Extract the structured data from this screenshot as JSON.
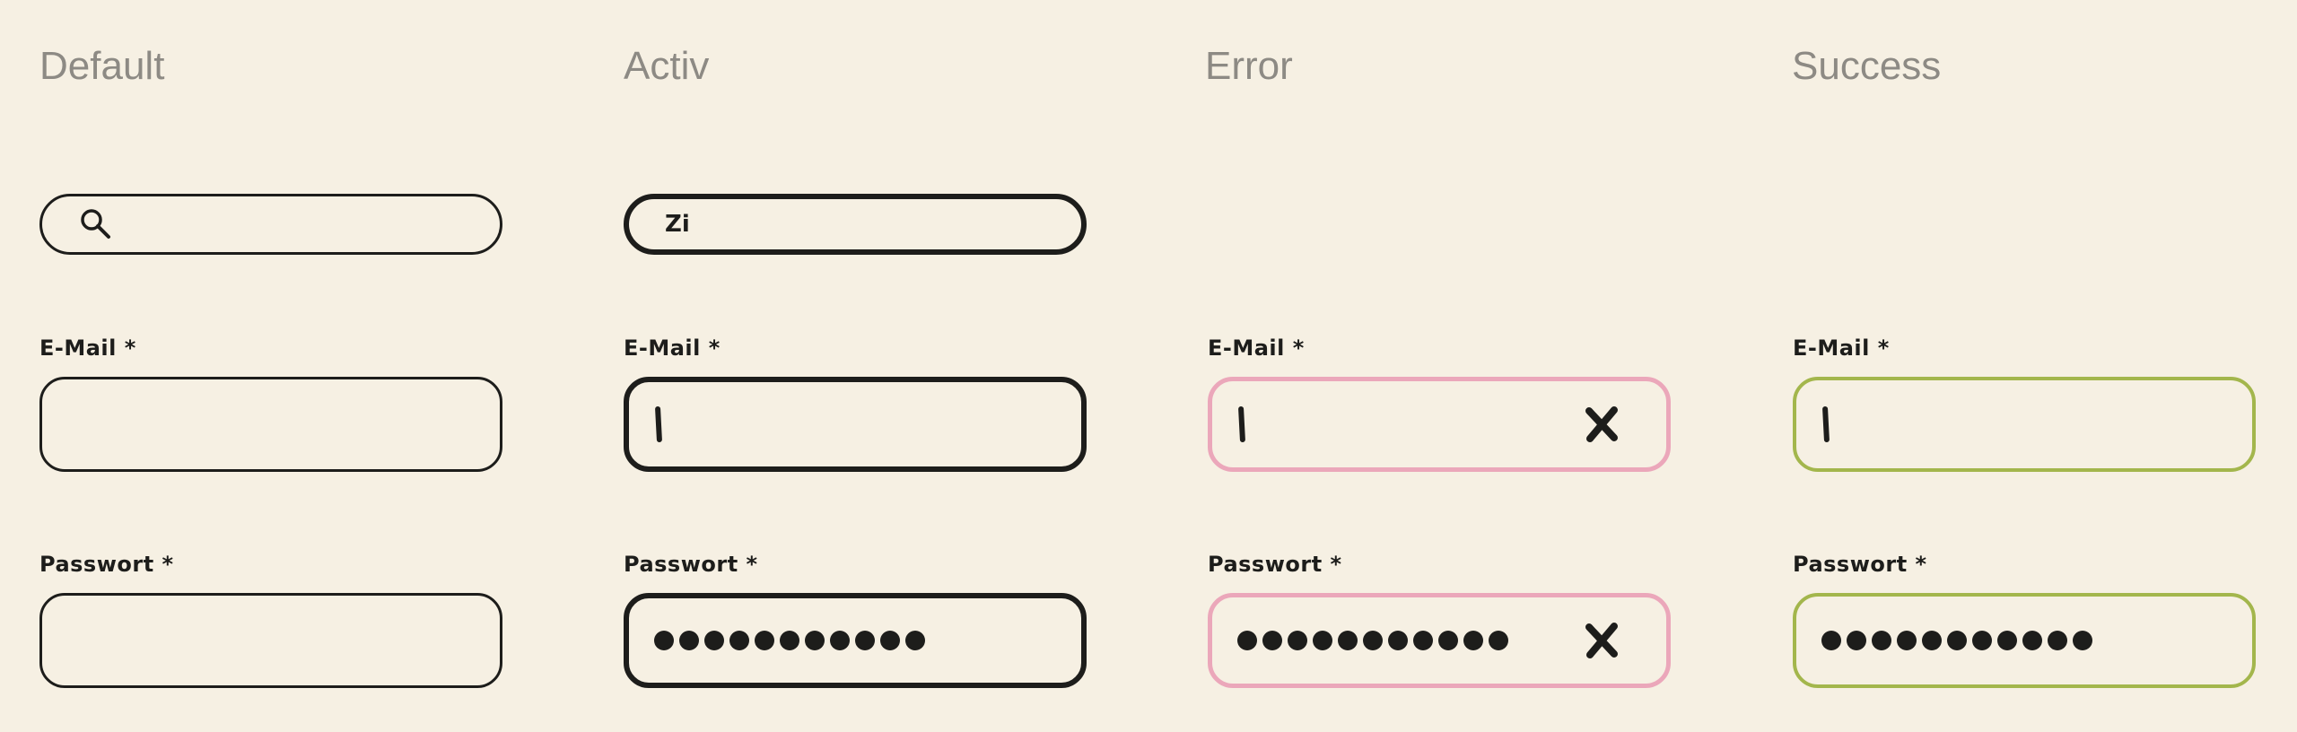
{
  "columns": {
    "default": {
      "title": "Default"
    },
    "active": {
      "title": "Activ",
      "search_value": "Zi"
    },
    "error": {
      "title": "Error"
    },
    "success": {
      "title": "Success"
    }
  },
  "labels": {
    "email": "E-Mail *",
    "password": "Passwort *"
  },
  "password_mask_length": 11,
  "colors": {
    "background": "#f6f0e3",
    "text": "#1d1d1b",
    "title_gray": "#8d8a84",
    "error_border": "#eba7ba",
    "success_border": "#a3b64c"
  },
  "icons": {
    "search": "search-icon",
    "clear": "close-icon"
  }
}
